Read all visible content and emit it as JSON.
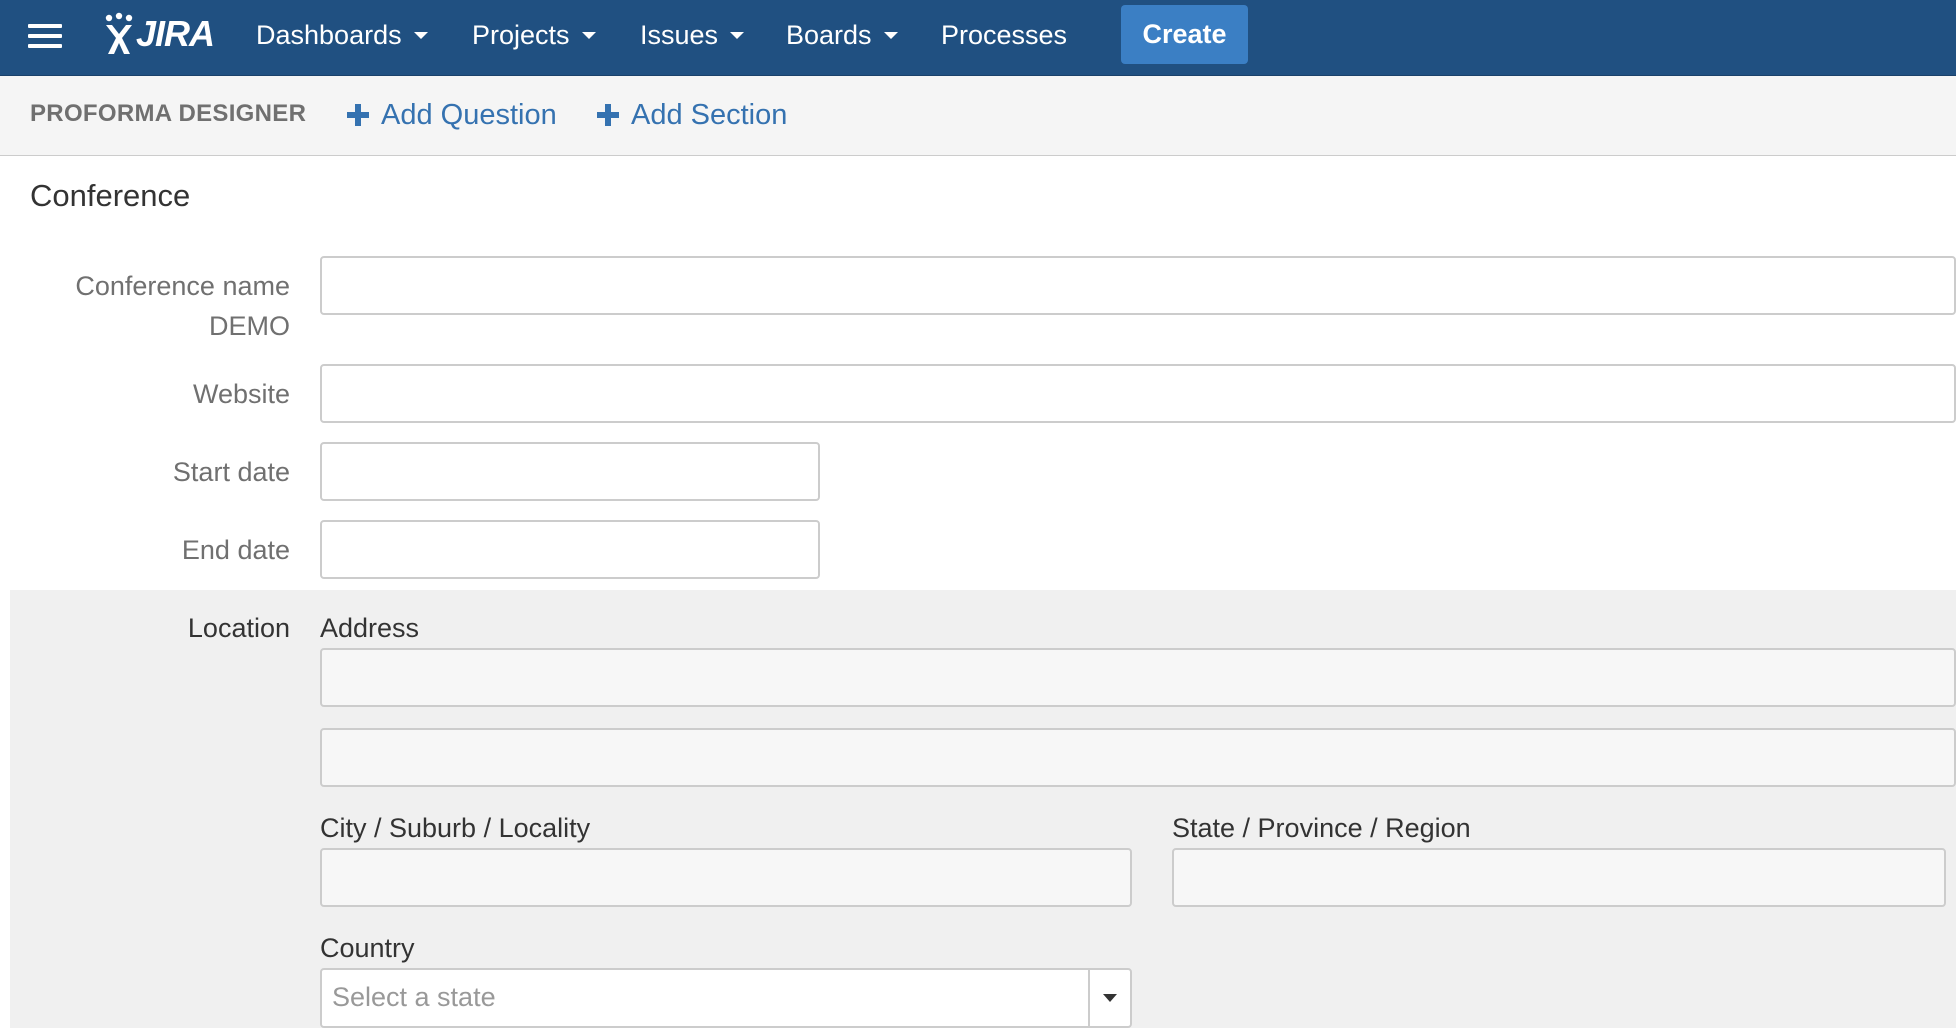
{
  "colors": {
    "nav_bg": "#205081",
    "create_button": "#3b7fc4",
    "link_blue": "#3572b0",
    "toolbar_bg": "#f5f5f5",
    "location_bg": "#f0f0f0"
  },
  "topnav": {
    "menu_icon": "hamburger-icon",
    "logo_text": "JIRA",
    "items": [
      {
        "label": "Dashboards",
        "has_dropdown": true
      },
      {
        "label": "Projects",
        "has_dropdown": true
      },
      {
        "label": "Issues",
        "has_dropdown": true
      },
      {
        "label": "Boards",
        "has_dropdown": true
      },
      {
        "label": "Processes",
        "has_dropdown": false
      }
    ],
    "create_label": "Create"
  },
  "toolbar": {
    "title": "PROFORMA DESIGNER",
    "add_question_label": "Add Question",
    "add_section_label": "Add Section",
    "add_icon": "plus-icon"
  },
  "form": {
    "section_title": "Conference",
    "fields": {
      "conference_name": {
        "label": "Conference name",
        "label_suffix": "DEMO",
        "value": ""
      },
      "website": {
        "label": "Website",
        "value": ""
      },
      "start_date": {
        "label": "Start date",
        "value": ""
      },
      "end_date": {
        "label": "End date",
        "value": ""
      }
    },
    "location": {
      "label": "Location",
      "address_label": "Address",
      "address_line1": "",
      "address_line2": "",
      "city_label": "City / Suburb / Locality",
      "city_value": "",
      "state_label": "State / Province / Region",
      "state_value": "",
      "country_label": "Country",
      "country_placeholder": "Select a state"
    }
  }
}
